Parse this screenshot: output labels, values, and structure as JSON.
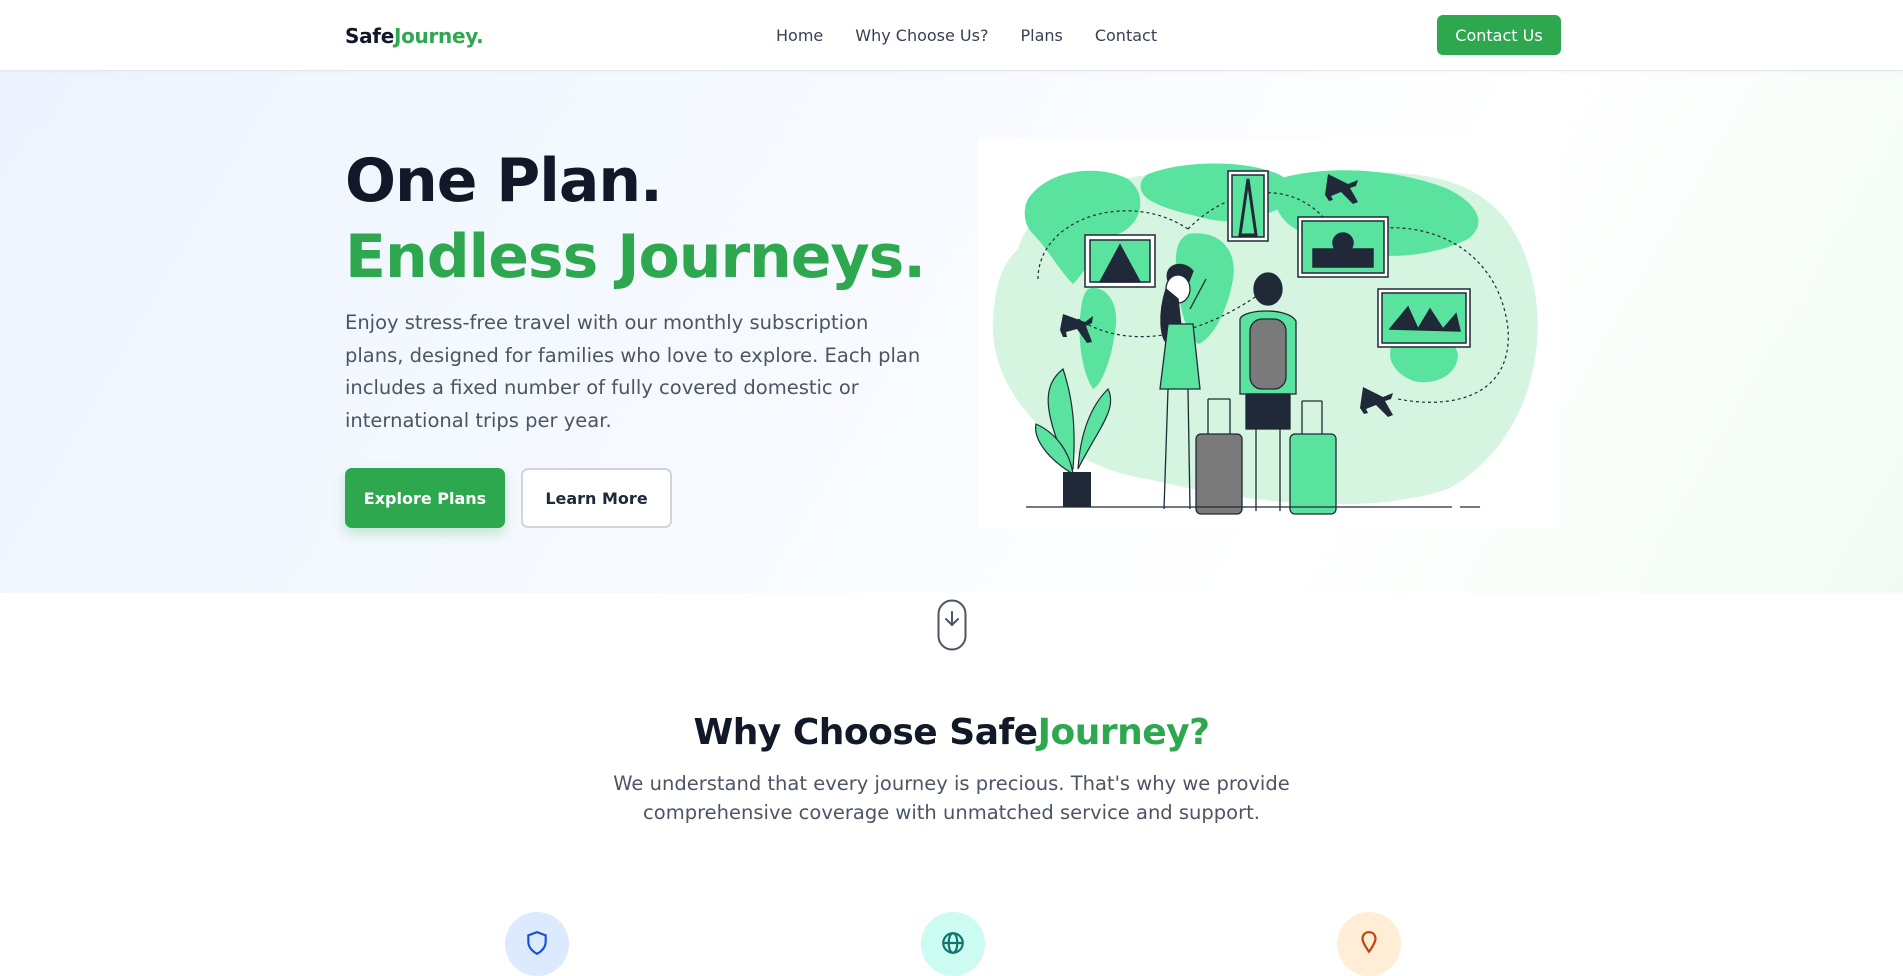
{
  "nav": {
    "logo_part1": "Safe",
    "logo_part2": "Journey.",
    "links": [
      "Home",
      "Why Choose Us?",
      "Plans",
      "Contact"
    ],
    "cta": "Contact Us"
  },
  "hero": {
    "title_line1": "One Plan.",
    "title_line2": "Endless Journeys.",
    "description": "Enjoy stress-free travel with our monthly subscription plans, designed for families who love to explore. Each plan includes a fixed number of fully covered domestic or international trips per year.",
    "primary_button": "Explore Plans",
    "secondary_button": "Learn More",
    "illustration": "travel-couple-world-map-illustration"
  },
  "scroll_indicator": {
    "icon": "mouse-scroll-down-icon"
  },
  "why_section": {
    "title_part1": "Why Choose Safe",
    "title_part2": "Journey?",
    "subtitle": "We understand that every journey is precious. That's why we provide comprehensive coverage with unmatched service and support.",
    "features": [
      {
        "icon": "shield-icon",
        "color": "#dbeafe"
      },
      {
        "icon": "globe-icon",
        "color": "#ccfbf1"
      },
      {
        "icon": "map-pin-icon",
        "color": "#ffedd5"
      }
    ]
  },
  "colors": {
    "brand": "#2ea84f",
    "dark": "#111827",
    "body": "#4b5563"
  }
}
